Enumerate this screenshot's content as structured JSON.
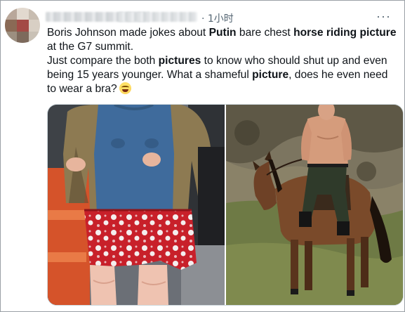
{
  "header": {
    "time_ago": "· 1小时",
    "more_label": "···"
  },
  "tweet": {
    "line1_a": "Boris Johnson made jokes about ",
    "line1_b": "Putin",
    "line1_c": " bare chest ",
    "line1_d": "horse riding picture",
    "line1_e": " at the G7 summit.",
    "line2_a": "Just compare the both ",
    "line2_b": "pictures",
    "line2_c": " to know who should shut up and even being 15 years younger. What a shameful ",
    "line2_d": "picture",
    "line2_e": ", does he even need to wear a bra?"
  },
  "media": {
    "count": 2
  },
  "icons": {
    "emoji": "laughing-with-tears-icon",
    "more": "ellipsis-icon"
  },
  "colors": {
    "text": "#0f1419",
    "secondary": "#536471",
    "border": "#cfd9de"
  }
}
